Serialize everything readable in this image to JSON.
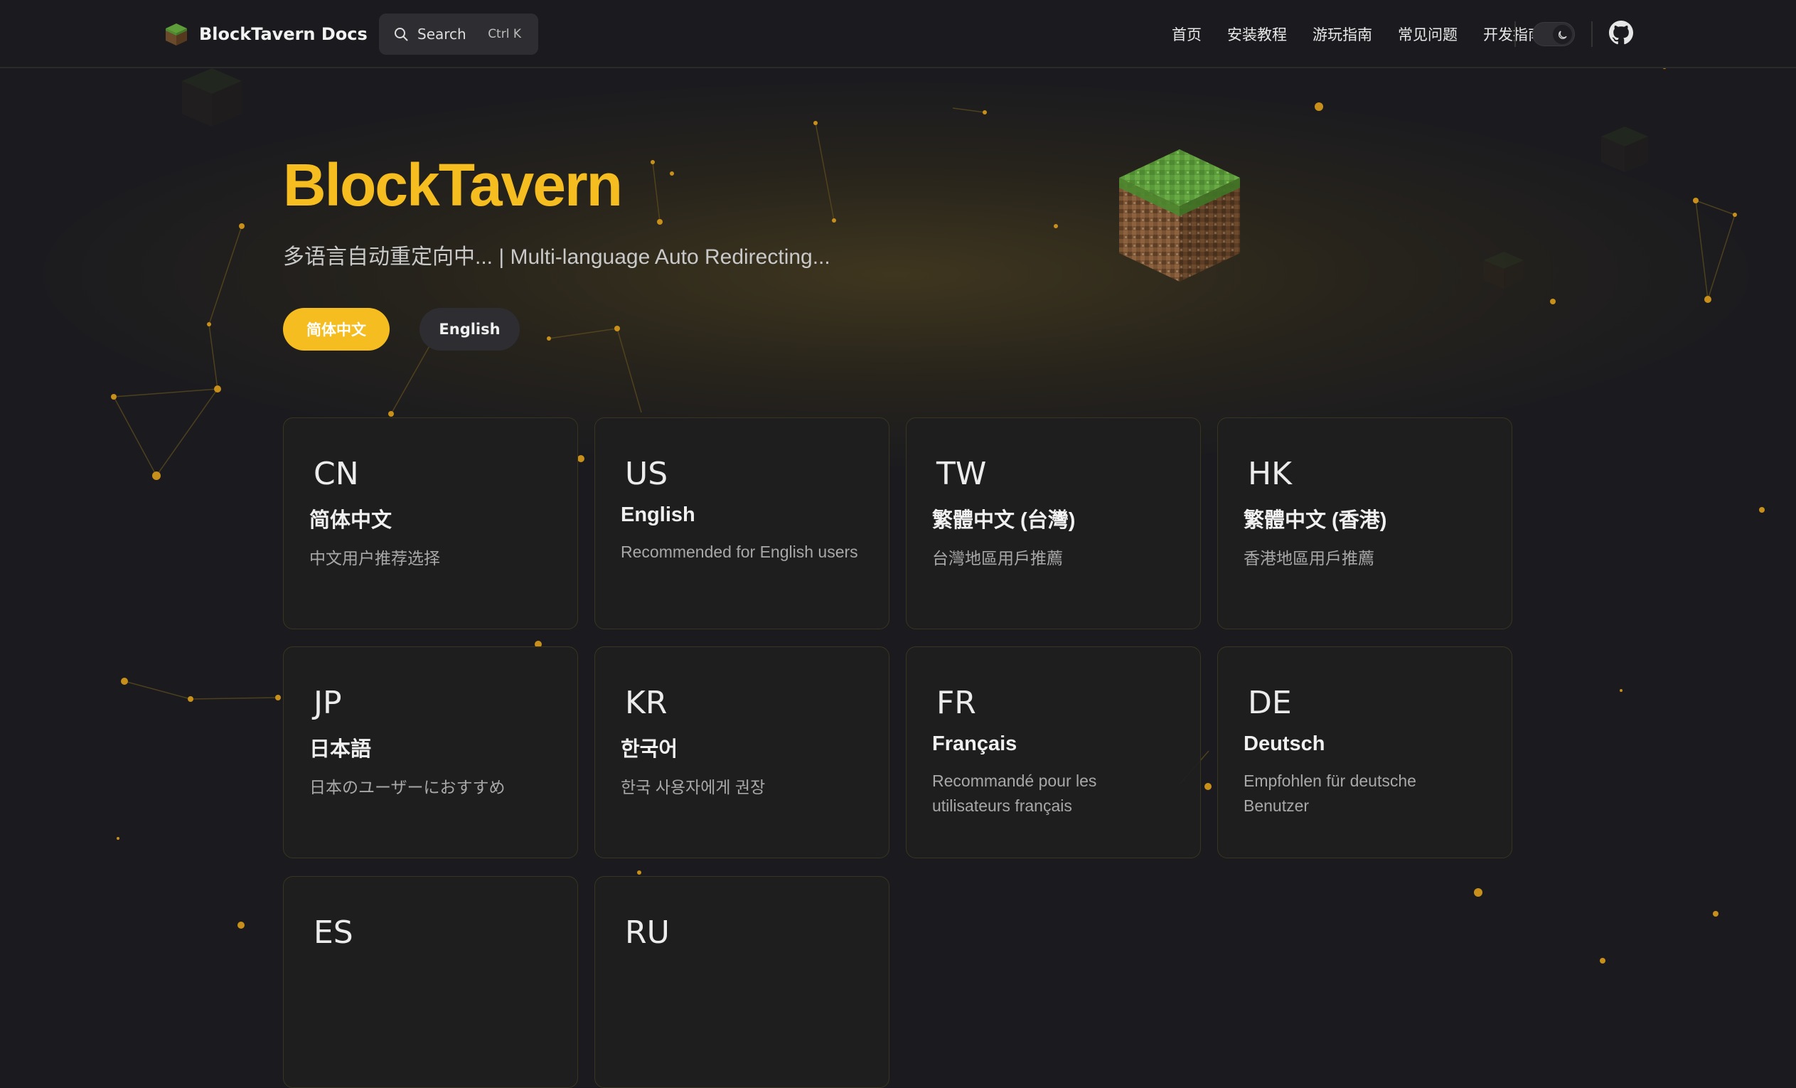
{
  "nav": {
    "brand_title": "BlockTavern Docs",
    "search_label": "Search",
    "search_shortcut": "Ctrl K",
    "links": [
      "首页",
      "安装教程",
      "游玩指南",
      "常见问题",
      "开发指南"
    ],
    "icons": {
      "brand": "grass-block-icon",
      "search": "search-icon",
      "theme": "moon-icon",
      "github": "github-icon"
    }
  },
  "hero": {
    "title": "BlockTavern",
    "tagline": "多语言自动重定向中... | Multi-language Auto Redirecting...",
    "actions": [
      "简体中文",
      "English"
    ],
    "image": "grass-block-image"
  },
  "features": [
    {
      "icon": "CN",
      "title": "简体中文",
      "details": "中文用户推荐选择"
    },
    {
      "icon": "US",
      "title": "English",
      "details": "Recommended for English users"
    },
    {
      "icon": "TW",
      "title": "繁體中文 (台灣)",
      "details": "台灣地區用戶推薦"
    },
    {
      "icon": "HK",
      "title": "繁體中文 (香港)",
      "details": "香港地區用戶推薦"
    },
    {
      "icon": "JP",
      "title": "日本語",
      "details": "日本のユーザーにおすすめ"
    },
    {
      "icon": "KR",
      "title": "한국어",
      "details": "한국 사용자에게 권장"
    },
    {
      "icon": "FR",
      "title": "Français",
      "details": "Recommandé pour les utilisateurs français"
    },
    {
      "icon": "DE",
      "title": "Deutsch",
      "details": "Empfohlen für deutsche Benutzer"
    },
    {
      "icon": "ES",
      "title": "",
      "details": ""
    },
    {
      "icon": "RU",
      "title": "",
      "details": ""
    }
  ],
  "colors": {
    "brand": "#f5bd1f",
    "background": "#1b1b1f",
    "card_border": "#3a3520"
  }
}
